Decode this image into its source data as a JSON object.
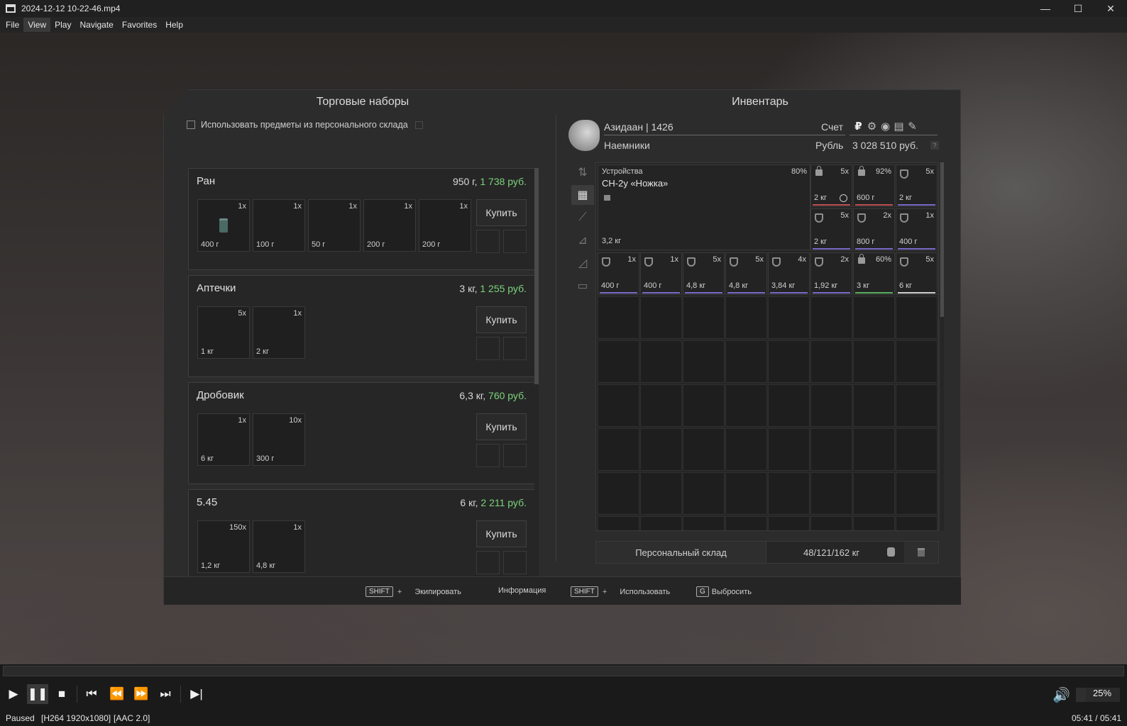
{
  "window": {
    "title": "2024-12-12 10-22-46.mp4",
    "min": "—",
    "max": "☐",
    "close": "✕"
  },
  "menu": [
    "File",
    "View",
    "Play",
    "Navigate",
    "Favorites",
    "Help"
  ],
  "trade": {
    "title": "Торговые наборы",
    "use_stock_label": "Использовать предметы из персонального склада",
    "buy_label": "Купить",
    "kits": [
      {
        "name": "Ран",
        "weight": "950 г, ",
        "price": "1 738 руб.",
        "slots": [
          {
            "count": "1x",
            "weight": "400 г"
          },
          {
            "count": "1x",
            "weight": "100 г"
          },
          {
            "count": "1x",
            "weight": "50 г"
          },
          {
            "count": "1x",
            "weight": "200 г"
          },
          {
            "count": "1x",
            "weight": "200 г"
          }
        ]
      },
      {
        "name": "Аптечки",
        "weight": "3 кг, ",
        "price": "1 255 руб.",
        "slots": [
          {
            "count": "5x",
            "weight": "1 кг"
          },
          {
            "count": "1x",
            "weight": "2 кг"
          }
        ]
      },
      {
        "name": "Дробовик",
        "weight": "6,3 кг, ",
        "price": "760 руб.",
        "slots": [
          {
            "count": "1x",
            "weight": "6 кг"
          },
          {
            "count": "10x",
            "weight": "300 г"
          }
        ]
      },
      {
        "name": "5.45",
        "weight": "6 кг, ",
        "price": "2 211 руб.",
        "slots": [
          {
            "count": "150x",
            "weight": "1,2 кг"
          },
          {
            "count": "1x",
            "weight": "4,8 кг"
          }
        ]
      }
    ]
  },
  "inventory": {
    "title": "Инвентарь",
    "player": "Азидаан | 1426",
    "faction": "Наемники",
    "account_label": "Счет",
    "currency_label": "Рубль",
    "balance": "3 028 510 руб.",
    "help": "?",
    "currency_icons": [
      "₽",
      "⚙",
      "◉",
      "▤",
      "✎"
    ],
    "tools": [
      "⇅",
      "▦",
      "⟋",
      "⊿",
      "◿",
      "▭"
    ],
    "big_item": {
      "category": "Устройства",
      "name": "СН-2у «Ножка»",
      "durability": "80%",
      "weight": "3,2 кг"
    },
    "items_row1": [
      {
        "lock": true,
        "count": "5x",
        "weight": "2 кг",
        "clock": true,
        "bar": "#c05050"
      },
      {
        "lock": true,
        "count": "92%",
        "weight": "600 г",
        "bar": "#c05050"
      },
      {
        "shield": true,
        "count": "5x",
        "weight": "2 кг",
        "bar": "#7a6ac8"
      }
    ],
    "items_row2": [
      {
        "shield": true,
        "count": "5x",
        "weight": "2 кг",
        "bar": "#7a6ac8"
      },
      {
        "shield": true,
        "count": "2x",
        "weight": "800 г",
        "bar": "#7a6ac8"
      },
      {
        "shield": true,
        "count": "1x",
        "weight": "400 г",
        "bar": "#7a6ac8"
      }
    ],
    "items_row3": [
      {
        "shield": true,
        "count": "1x",
        "weight": "400 г",
        "bar": "#7a6ac8"
      },
      {
        "shield": true,
        "count": "1x",
        "weight": "400 г",
        "bar": "#7a6ac8"
      },
      {
        "shield": true,
        "count": "5x",
        "weight": "4,8 кг",
        "bar": "#7a6ac8"
      },
      {
        "shield": true,
        "count": "5x",
        "weight": "4,8 кг",
        "bar": "#7a6ac8"
      },
      {
        "shield": true,
        "count": "4x",
        "weight": "3,84 кг",
        "bar": "#7a6ac8"
      },
      {
        "shield": true,
        "count": "2x",
        "weight": "1,92 кг",
        "bar": "#7a6ac8"
      },
      {
        "lock": true,
        "count": "60%",
        "weight": "3 кг",
        "bar": "#5ab060"
      },
      {
        "shield": true,
        "count": "5x",
        "weight": "6 кг",
        "bar": "#d0d0d0"
      }
    ],
    "stock_tab": "Персональный склад",
    "stock_weight": "48/121/162 кг"
  },
  "hints": {
    "shift": "SHIFT",
    "plus": "+",
    "equip": "Экипировать",
    "info": "Информация",
    "use": "Использовать",
    "g": "G",
    "drop": "Выбросить"
  },
  "player_controls": {
    "play": "▶",
    "pause": "❚❚",
    "stop": "■",
    "prev": "⏮",
    "rew": "⏪",
    "fwd": "⏩",
    "next": "⏭",
    "frame": "▶|",
    "volume_icon": "🔊",
    "volume": "25%"
  },
  "status": {
    "state": "Paused",
    "video": "[H264 1920x1080]",
    "audio": "[AAC 2.0]",
    "time": "05:41 / 05:41"
  }
}
